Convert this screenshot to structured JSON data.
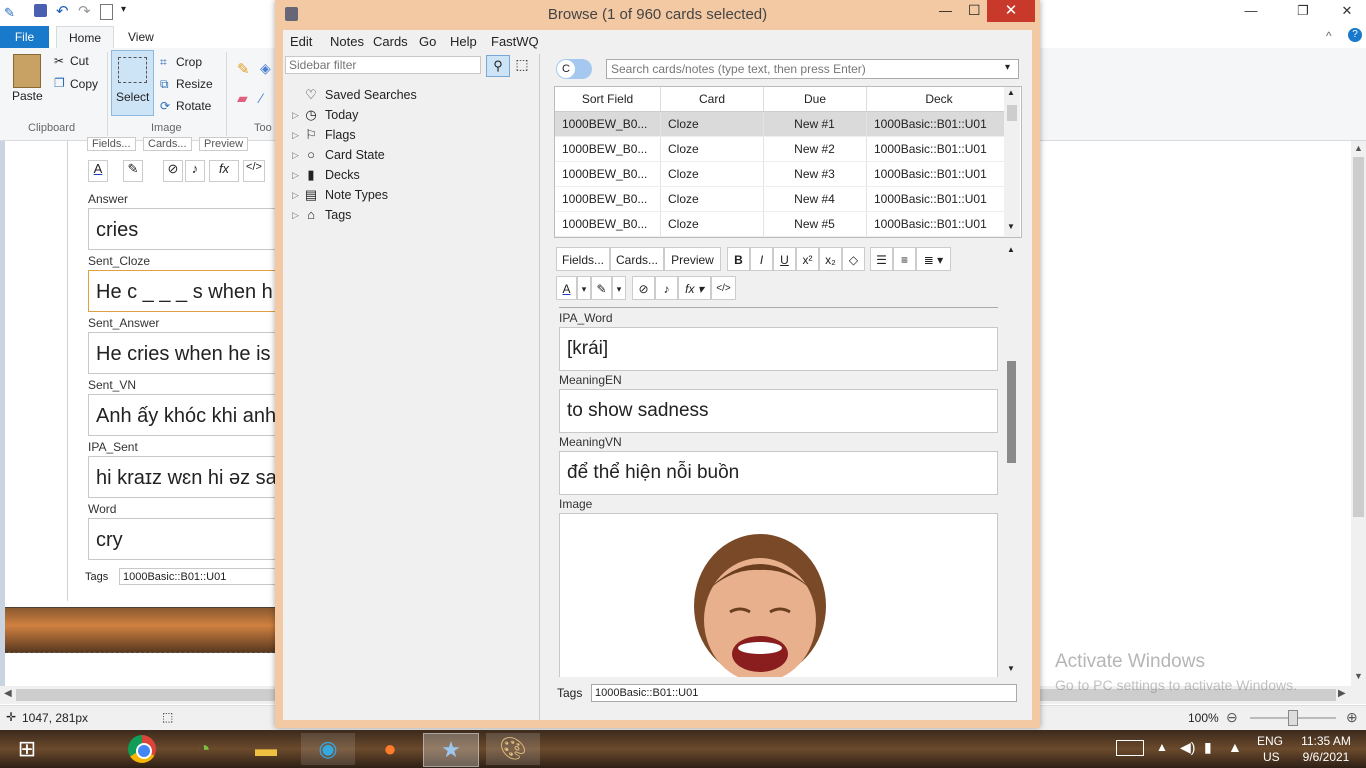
{
  "paint": {
    "tabs": {
      "file": "File",
      "home": "Home",
      "view": "View"
    },
    "ribbon": {
      "paste": "Paste",
      "cut": "Cut",
      "copy": "Copy",
      "select": "Select",
      "crop": "Crop",
      "resize": "Resize",
      "rotate": "Rotate",
      "group_clipboard": "Clipboard",
      "group_image": "Image",
      "group_tools": "Too"
    },
    "status": {
      "cursor_pos": "1047, 281px",
      "zoom": "100%"
    }
  },
  "back_editor": {
    "tabs": [
      "Fields...",
      "Cards...",
      "Preview"
    ],
    "fields": [
      {
        "label": "Answer",
        "value": "cries"
      },
      {
        "label": "Sent_Cloze",
        "value": "He c _ _ _ s when h"
      },
      {
        "label": "Sent_Answer",
        "value": "He cries when he is"
      },
      {
        "label": "Sent_VN",
        "value": "Anh ấy khóc khi anh"
      },
      {
        "label": "IPA_Sent",
        "value": "hi kraɪz wɛn hi əz sa"
      },
      {
        "label": "Word",
        "value": "cry"
      }
    ],
    "tags_label": "Tags",
    "tags_value": "1000Basic::B01::U01"
  },
  "browse": {
    "title": "Browse (1 of 960 cards selected)",
    "menu": [
      "Edit",
      "Notes",
      "Cards",
      "Go",
      "Help",
      "FastWQ"
    ],
    "sidebar_filter_placeholder": "Sidebar filter",
    "toggle_label": "C",
    "search_placeholder": "Search cards/notes (type text, then press Enter)",
    "sidebar": [
      {
        "label": "Saved Searches",
        "icon": "heart-icon",
        "glyph": "♡",
        "arrow": false
      },
      {
        "label": "Today",
        "icon": "clock-icon",
        "glyph": "◷",
        "arrow": true
      },
      {
        "label": "Flags",
        "icon": "flag-icon",
        "glyph": "⚐",
        "arrow": true
      },
      {
        "label": "Card State",
        "icon": "circle-icon",
        "glyph": "○",
        "arrow": true
      },
      {
        "label": "Decks",
        "icon": "deck-icon",
        "glyph": "▮",
        "arrow": true
      },
      {
        "label": "Note Types",
        "icon": "note-types-icon",
        "glyph": "▤",
        "arrow": true
      },
      {
        "label": "Tags",
        "icon": "tag-icon",
        "glyph": "⌂",
        "arrow": true
      }
    ],
    "table": {
      "columns": [
        "Sort Field",
        "Card",
        "Due",
        "Deck"
      ],
      "rows": [
        [
          "1000BEW_B0...",
          "Cloze",
          "New #1",
          "1000Basic::B01::U01"
        ],
        [
          "1000BEW_B0...",
          "Cloze",
          "New #2",
          "1000Basic::B01::U01"
        ],
        [
          "1000BEW_B0...",
          "Cloze",
          "New #3",
          "1000Basic::B01::U01"
        ],
        [
          "1000BEW_B0...",
          "Cloze",
          "New #4",
          "1000Basic::B01::U01"
        ],
        [
          "1000BEW_B0...",
          "Cloze",
          "New #5",
          "1000Basic::B01::U01"
        ]
      ]
    },
    "editor": {
      "fields_btn": "Fields...",
      "cards_btn": "Cards...",
      "preview_btn": "Preview",
      "fields": [
        {
          "label": "IPA_Word",
          "value": "[krái]"
        },
        {
          "label": "MeaningEN",
          "value": "to show sadness"
        },
        {
          "label": "MeaningVN",
          "value": "để thể hiện nỗi buồn"
        }
      ],
      "image_label": "Image",
      "tags_label": "Tags",
      "tags_value": "1000Basic::B01::U01"
    }
  },
  "watermark": {
    "line1": "Activate Windows",
    "line2": "Go to PC settings to activate Windows."
  },
  "taskbar": {
    "lang": "ENG",
    "region": "US",
    "time": "11:35 AM",
    "date": "9/6/2021"
  }
}
